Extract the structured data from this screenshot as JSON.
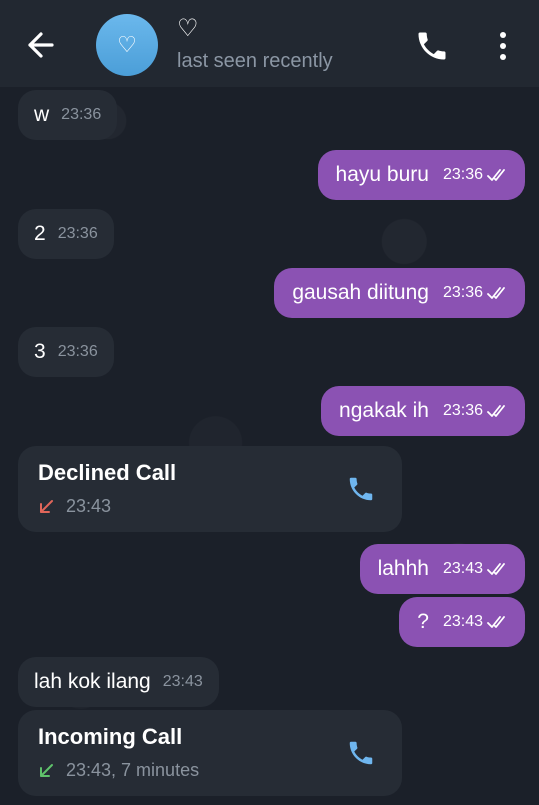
{
  "header": {
    "title": "♡",
    "avatar_glyph": "♡",
    "status": "last seen recently",
    "back_icon": "arrow-left-icon",
    "call_icon": "phone-icon",
    "menu_icon": "more-vertical-icon"
  },
  "colors": {
    "outgoing_bubble": "#8b52b3",
    "incoming_bubble": "#262c35",
    "avatar": "#5aaee3",
    "call_accent": "#6fb6ef",
    "declined_arrow": "#e0665a",
    "incoming_arrow": "#5fc26b"
  },
  "messages": [
    {
      "dir": "in",
      "text": "w",
      "time": "23:36"
    },
    {
      "dir": "out",
      "text": "hayu buru",
      "time": "23:36"
    },
    {
      "dir": "in",
      "text": "2",
      "time": "23:36"
    },
    {
      "dir": "out",
      "text": "gausah diitung",
      "time": "23:36"
    },
    {
      "dir": "in",
      "text": "3",
      "time": "23:36"
    },
    {
      "dir": "out",
      "text": "ngakak ih",
      "time": "23:36"
    },
    {
      "dir": "out",
      "text": "lahhh",
      "time": "23:43"
    },
    {
      "dir": "out",
      "text": "?",
      "time": "23:43"
    },
    {
      "dir": "in",
      "text": "lah kok ilang",
      "time": "23:43"
    }
  ],
  "calls": [
    {
      "title": "Declined Call",
      "meta": "23:43",
      "direction_icon": "arrow-down-left-icon"
    },
    {
      "title": "Incoming Call",
      "meta": "23:43, 7 minutes",
      "direction_icon": "arrow-down-left-icon"
    }
  ]
}
